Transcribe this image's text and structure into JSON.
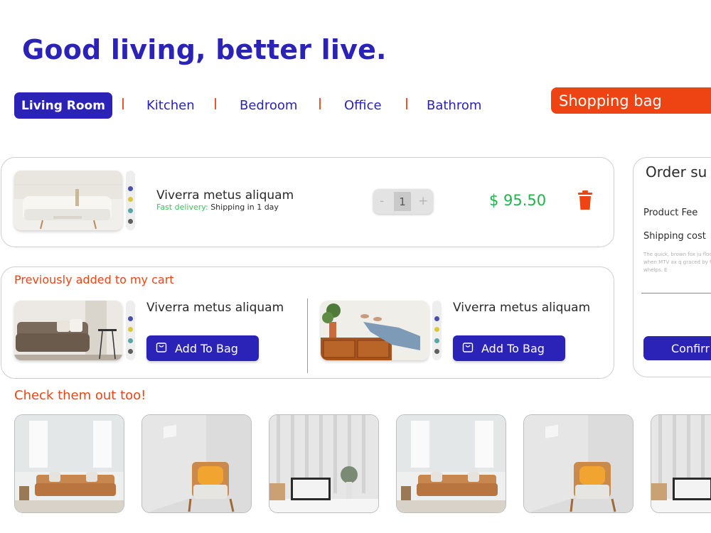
{
  "headline": "Good living, better live.",
  "tabs": [
    {
      "label": "Living Room",
      "active": true
    },
    {
      "label": "Kitchen"
    },
    {
      "label": "Bedroom"
    },
    {
      "label": "Office"
    },
    {
      "label": "Bathrom"
    }
  ],
  "shopping_bag_label": "Shopping bag",
  "cart_item": {
    "title": "Viverra metus aliquam",
    "fast_delivery_label": "Fast delivery:",
    "delivery_text": "Shipping in 1 day",
    "quantity": "1",
    "minus": "-",
    "plus": "+",
    "price": "$ 95.50",
    "swatches": [
      "#4a4fa8",
      "#d9c93a",
      "#5aa6a6",
      "#5f5f5f"
    ]
  },
  "previous": {
    "title": "Previously added to my cart",
    "items": [
      {
        "title": "Viverra metus aliquam",
        "button": "Add To Bag"
      },
      {
        "title": "Viverra metus aliquam",
        "button": "Add To Bag"
      }
    ]
  },
  "order_summary": {
    "title": "Order su",
    "product_fee_label": "Product Fee",
    "shipping_cost_label": "Shipping cost",
    "note": "The quick, brown fox ju flock by when MTV ax q graced by fox whelps. E",
    "confirm_label": "Confirr"
  },
  "check_out": {
    "title": "Check them out too!",
    "thumbnails": [
      "living-room-sofa",
      "armchair-corner",
      "desk-laptop",
      "living-room-sofa",
      "armchair-corner",
      "desk-laptop"
    ]
  },
  "colors": {
    "brand_blue": "#2b23b7",
    "accent_orange": "#ee4414",
    "price_green": "#21b34a"
  }
}
